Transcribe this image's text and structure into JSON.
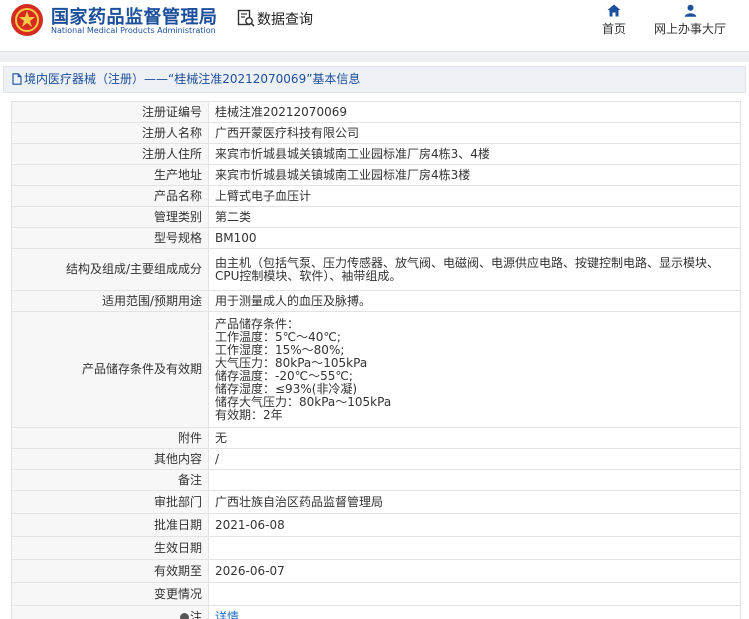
{
  "header": {
    "logo_cn": "国家药品监督管理局",
    "logo_en": "National Medical Products Administration",
    "query_label": "数据查询",
    "nav": {
      "home": "首页",
      "online_office": "网上办事大厅"
    },
    "brand_color": "#1c4f9c"
  },
  "breadcrumb": "境内医疗器械（注册）——“桂械注准20212070069”基本信息",
  "fields": [
    {
      "label": "注册证编号",
      "value": "桂械注准20212070069"
    },
    {
      "label": "注册人名称",
      "value": "广西开蒙医疗科技有限公司"
    },
    {
      "label": "注册人住所",
      "value": "来宾市忻城县城关镇城南工业园标准厂房4栋3、4楼"
    },
    {
      "label": "生产地址",
      "value": "来宾市忻城县城关镇城南工业园标准厂房4栋3楼"
    },
    {
      "label": "产品名称",
      "value": "上臂式电子血压计"
    },
    {
      "label": "管理类别",
      "value": "第二类"
    },
    {
      "label": "型号规格",
      "value": "BM100"
    },
    {
      "label": "结构及组成/主要组成成分",
      "value": "由主机（包括气泵、压力传感器、放气阀、电磁阀、电源供应电路、按键控制电路、显示模块、CPU控制模块、软件）、袖带组成。"
    },
    {
      "label": "适用范围/预期用途",
      "value": "用于测量成人的血压及脉搏。"
    },
    {
      "label": "产品储存条件及有效期",
      "value": "产品储存条件：\n工作温度：5℃～40℃;\n工作湿度：15%～80%;\n大气压力：80kPa～105kPa\n储存温度：-20℃～55℃;\n储存湿度：≤93%(非冷凝)\n储存大气压力：80kPa～105kPa\n有效期：2年"
    },
    {
      "label": "附件",
      "value": "无"
    },
    {
      "label": "其他内容",
      "value": "/"
    },
    {
      "label": "备注",
      "value": ""
    },
    {
      "label": "审批部门",
      "value": "广西壮族自治区药品监督管理局"
    },
    {
      "label": "批准日期",
      "value": "2021-06-08"
    },
    {
      "label": "生效日期",
      "value": ""
    },
    {
      "label": "有效期至",
      "value": "2026-06-07"
    },
    {
      "label": "变更情况",
      "value": ""
    },
    {
      "label": "注",
      "value": "详情"
    }
  ]
}
